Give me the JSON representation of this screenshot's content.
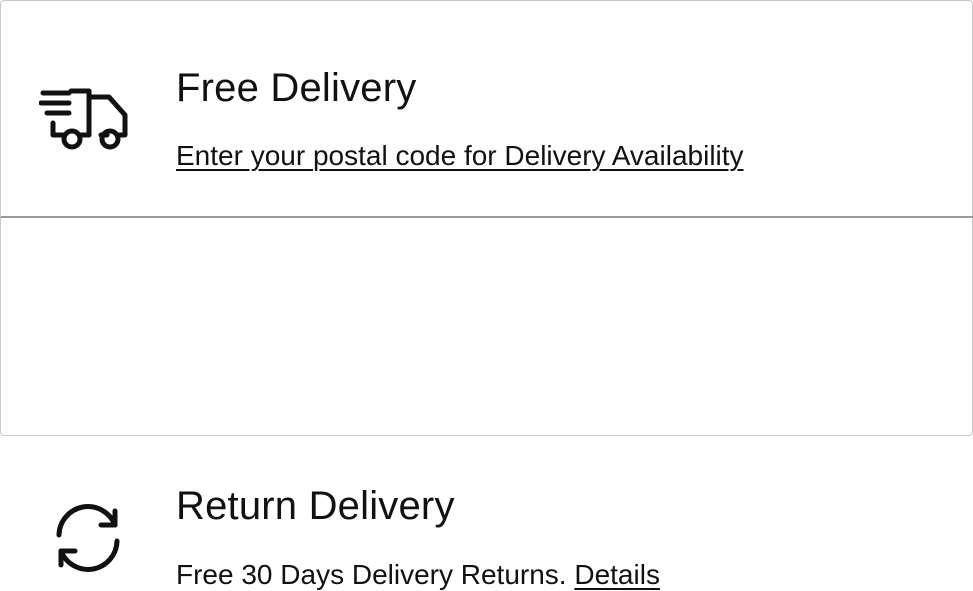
{
  "delivery": {
    "icon": "delivery-truck-icon",
    "title": "Free Delivery",
    "link_text": "Enter your postal code for Delivery Availability"
  },
  "returns": {
    "icon": "return-sync-icon",
    "title": "Return Delivery",
    "text": "Free 30 Days Delivery Returns.",
    "link_text": "Details"
  }
}
